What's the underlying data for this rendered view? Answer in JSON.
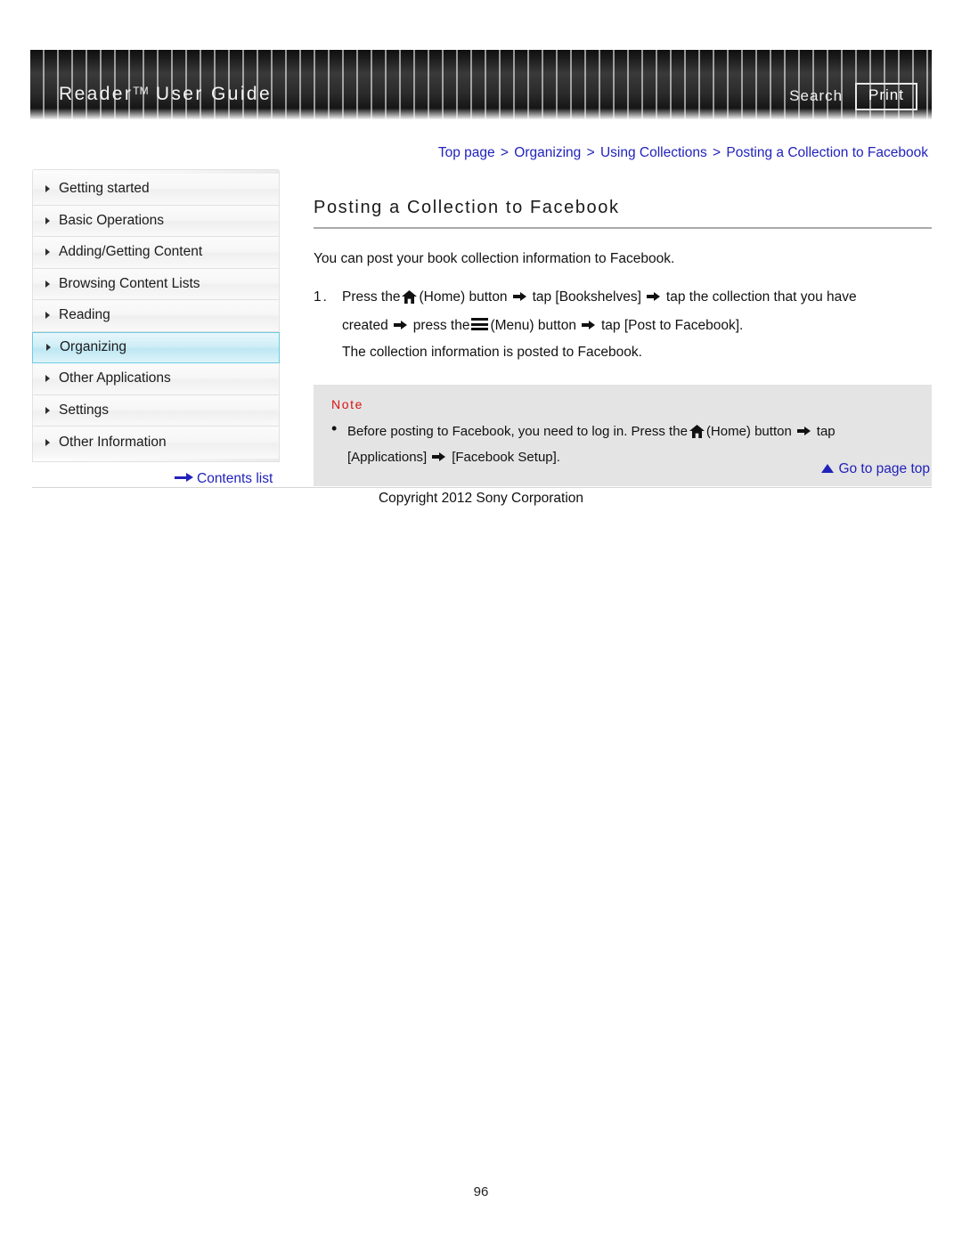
{
  "header": {
    "title": "Reader",
    "title_tm": "TM",
    "title_rest": " User Guide",
    "search_label": "Search",
    "print_label": "Print"
  },
  "breadcrumb": {
    "items": [
      "Top page",
      "Organizing",
      "Using Collections",
      "Posting a Collection to Facebook"
    ],
    "separator": ">"
  },
  "sidebar": {
    "items": [
      {
        "label": "Getting started",
        "active": false
      },
      {
        "label": "Basic Operations",
        "active": false
      },
      {
        "label": "Adding/Getting Content",
        "active": false
      },
      {
        "label": "Browsing Content Lists",
        "active": false
      },
      {
        "label": "Reading",
        "active": false
      },
      {
        "label": "Organizing",
        "active": true
      },
      {
        "label": "Other Applications",
        "active": false
      },
      {
        "label": "Settings",
        "active": false
      },
      {
        "label": "Other Information",
        "active": false
      }
    ]
  },
  "main": {
    "title": "Posting a Collection to Facebook",
    "intro": "You can post your book collection information to Facebook.",
    "step": {
      "number": "1.",
      "p1": "Press the",
      "home_label": "(Home) button",
      "p2": "tap [Bookshelves]",
      "p3": "tap the collection that you have",
      "line2_a": "created",
      "line2_b": "press the",
      "menu_label": "(Menu) button",
      "line2_c": "tap [Post to Facebook].",
      "result": "The collection information is posted to Facebook."
    },
    "note": {
      "label": "Note",
      "bullet": "•",
      "text_a": "Before posting to Facebook, you need to log in. Press the",
      "home_label": "(Home) button",
      "text_b": "tap",
      "text_c": "[Applications]",
      "text_d": "[Facebook Setup]."
    }
  },
  "footer": {
    "goto_top_label": "Go to page top",
    "contents_list_label": "Contents list",
    "copyright": "Copyright 2012 Sony Corporation",
    "page_number": "96"
  },
  "colors": {
    "link": "#2222bb",
    "note_label": "#d81414",
    "active_nav_border": "#6fcbe2",
    "note_bg": "#e4e4e4"
  }
}
